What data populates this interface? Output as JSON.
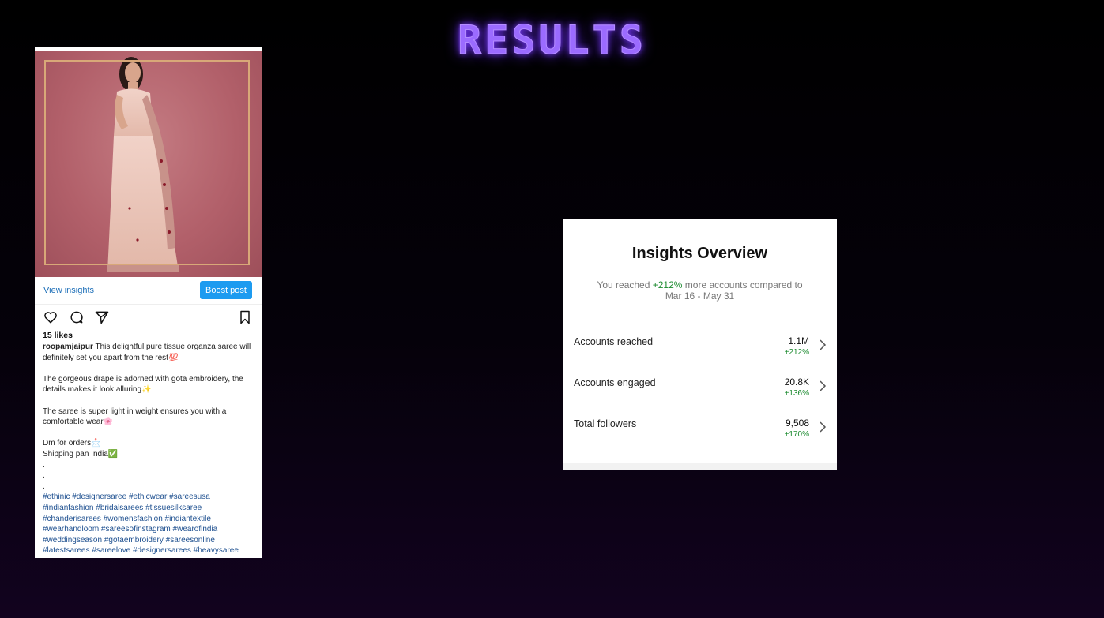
{
  "heading": "RESULTS",
  "post": {
    "view_insights": "View insights",
    "boost_post": "Boost post",
    "likes": "15 likes",
    "username": "roopamjaipur",
    "caption_lines": [
      "This delightful pure tissue organza saree will definitely set you apart from the rest💯",
      "The gorgeous drape is adorned with gota embroidery, the details makes it look alluring✨",
      "The saree is super light in weight ensures you with a comfortable wear🌸",
      "Dm for orders📩",
      "Shipping pan India✅",
      ".",
      ".",
      "."
    ],
    "hashtags": [
      "#ethinic #designersaree #ethicwear #sareesusa",
      "#indianfashion #bridalsarees #tissuesilksaree",
      "#chanderisarees #womensfashion #indiantextile",
      "#wearhandloom #sareesofinstagram #wearofindia",
      "#weddingseason #gotaembroidery #sareesonline",
      "#latestsarees #sareelove #designersarees #heavysaree"
    ]
  },
  "insights": {
    "title": "Insights Overview",
    "summary_prefix": "You reached ",
    "summary_pct": "+212%",
    "summary_suffix": " more accounts compared to",
    "summary_range": "Mar 16 - May 31",
    "metrics": [
      {
        "label": "Accounts reached",
        "value": "1.1M",
        "change": "+212%"
      },
      {
        "label": "Accounts engaged",
        "value": "20.8K",
        "change": "+136%"
      },
      {
        "label": "Total followers",
        "value": "9,508",
        "change": "+170%"
      }
    ]
  },
  "colors": {
    "heading": "#9b6bff",
    "positive": "#1a8a2e",
    "boost": "#1d9bf0",
    "link": "#1d6fb8"
  }
}
